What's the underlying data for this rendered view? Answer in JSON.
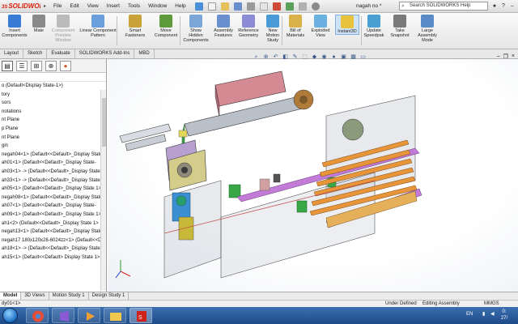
{
  "app": {
    "logo": "SOLIDWORKS",
    "logo_prefix": "3S",
    "doc_title": "nagah no *"
  },
  "menu": [
    "File",
    "Edit",
    "View",
    "Insert",
    "Tools",
    "Window",
    "Help"
  ],
  "help_search": {
    "placeholder": "Search SOLIDWORKS Help"
  },
  "ribbon": [
    {
      "label": "Insert\nComponents",
      "icon": "insert-components-icon",
      "color": "#3a7bd5"
    },
    {
      "label": "Mate",
      "icon": "mate-icon",
      "color": "#8a8a8a"
    },
    {
      "label": "Component\nPreview\nWindow",
      "icon": "preview-window-icon",
      "color": "#bbbbbb",
      "disabled": true
    },
    {
      "label": "Linear Component\nPattern",
      "icon": "linear-pattern-icon",
      "color": "#6b9fdc"
    },
    {
      "label": "Smart\nFasteners",
      "icon": "smart-fasteners-icon",
      "color": "#c9a23a"
    },
    {
      "label": "Move\nComponent",
      "icon": "move-component-icon",
      "color": "#5e9a3a"
    },
    {
      "label": "Show\nHidden\nComponents",
      "icon": "show-hidden-icon",
      "color": "#7aa7d8"
    },
    {
      "label": "Assembly\nFeatures",
      "icon": "assembly-features-icon",
      "color": "#6a8fcf"
    },
    {
      "label": "Reference\nGeometry",
      "icon": "reference-geometry-icon",
      "color": "#8b8bd6"
    },
    {
      "label": "New\nMotion\nStudy",
      "icon": "motion-study-icon",
      "color": "#4a9ad8"
    },
    {
      "label": "Bill of\nMaterials",
      "icon": "bom-icon",
      "color": "#d9b24a"
    },
    {
      "label": "Exploded\nView",
      "icon": "exploded-view-icon",
      "color": "#6ab0e0"
    },
    {
      "label": "Instant3D",
      "icon": "instant3d-icon",
      "color": "#e8c23a",
      "active": true
    },
    {
      "label": "Update\nSpeedpak",
      "icon": "speedpak-icon",
      "color": "#4aa0d0"
    },
    {
      "label": "Take\nSnapshot",
      "icon": "snapshot-icon",
      "color": "#7a7a7a"
    },
    {
      "label": "Large\nAssembly\nMode",
      "icon": "large-assembly-icon",
      "color": "#5c8cc8"
    }
  ],
  "tabs": [
    "Layout",
    "Sketch",
    "Evaluate",
    "SOLIDWORKS Add-Ins",
    "MBD"
  ],
  "feature_tree": [
    "o  (Default<Display State-1>)",
    "tory",
    "sors",
    "notations",
    "nt Plane",
    "p Plane",
    "nt Plane",
    "gin",
    "negah04<1> (Default<<Default>_Display State",
    "ah01<1> (Default<<Default>_Display State-",
    "ah03<1> -> (Default<<Default>_Display State",
    "ah33<1> -> (Default<<Default>_Display State",
    "ah05<1> (Default<<Default>_Display State 1>",
    "negah08<1> (Default<<Default>_Display State",
    "ah07<1> (Default<<Default>_Display State-",
    "ah09<1> (Default<<Default>_Display State 1>",
    "ah1<2> (Default<<Default>_Display State 1>",
    "negah13<1> (Default<<Default>_Display State",
    "negah17 180x120x28-6024zz<1> (Default<<De",
    "ah18<1> -> (Default<<Default>_Display State",
    "ah15<1> (Default<<Default> Display State 1>"
  ],
  "model_tabs": [
    "Model",
    "3D Views",
    "Motion Study 1",
    "Design Study 1"
  ],
  "status": {
    "left": "dy01<1>",
    "under": "Under Defined",
    "editing": "Editing Assembly",
    "units": "MMGS"
  },
  "taskbar": {
    "lang": "EN",
    "time": "0:",
    "date": "27/"
  },
  "colors": {
    "accent": "#3a7bd5",
    "taskbar": "#2a5c9e",
    "roller": "#e8953a",
    "rod": "#c27bd6"
  }
}
